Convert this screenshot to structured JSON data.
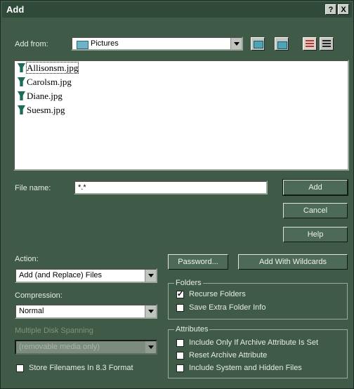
{
  "window": {
    "title": "Add",
    "help_btn": "?",
    "close_btn": "X"
  },
  "add_from": {
    "label": "Add from:",
    "value": "Pictures"
  },
  "files": [
    {
      "name": "Allisonsm.jpg",
      "selected": true
    },
    {
      "name": "Carolsm.jpg",
      "selected": false
    },
    {
      "name": "Diane.jpg",
      "selected": false
    },
    {
      "name": "Suesm.jpg",
      "selected": false
    }
  ],
  "file_name": {
    "label": "File name:",
    "value": "*.*"
  },
  "buttons": {
    "add": "Add",
    "cancel": "Cancel",
    "help": "Help",
    "password": "Password...",
    "add_with_wildcards": "Add With Wildcards"
  },
  "action": {
    "label": "Action:",
    "value": "Add (and Replace) Files"
  },
  "compression": {
    "label": "Compression:",
    "value": "Normal"
  },
  "multiple_disk": {
    "label": "Multiple Disk Spanning",
    "value": "(removable media only)"
  },
  "store_filenames": {
    "label": "Store Filenames In 8.3 Format",
    "checked": false
  },
  "folders": {
    "title": "Folders",
    "recurse": {
      "label": "Recurse Folders",
      "checked": true
    },
    "save_extra": {
      "label": "Save Extra Folder Info",
      "checked": false
    }
  },
  "attributes": {
    "title": "Attributes",
    "only_archive": {
      "label": "Include Only If Archive Attribute Is Set",
      "checked": false
    },
    "reset_archive": {
      "label": "Reset Archive Attribute",
      "checked": false
    },
    "system_hidden": {
      "label": "Include System and Hidden Files",
      "checked": false
    }
  }
}
